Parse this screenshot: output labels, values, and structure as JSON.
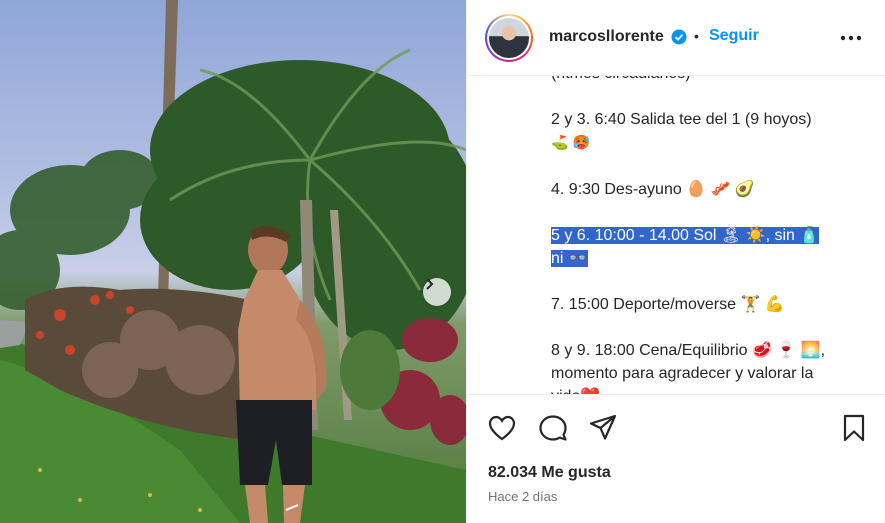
{
  "post": {
    "username": "marcosllorente",
    "follow_label": "Seguir",
    "separator": "•"
  },
  "caption": {
    "lines": [
      {
        "text": "(ritmos circadianos)",
        "highlight": false,
        "para_end": true
      },
      {
        "text": "2 y 3. 6:40 Salida tee del 1 (9 hoyos)",
        "highlight": false,
        "para_end": false
      },
      {
        "text": "⛳ 🥵",
        "highlight": false,
        "para_end": true,
        "emoji": true
      },
      {
        "text": "4. 9:30 Des-ayuno 🥚 🥓 🥑",
        "highlight": false,
        "para_end": true
      },
      {
        "text": "5 y 6. 10:00 - 14.00 Sol 🏝 ☀️, sin 🧴",
        "highlight": true,
        "para_end": false
      },
      {
        "text": "ni 👓",
        "highlight": true,
        "para_end": true
      },
      {
        "text": "7. 15:00 Deporte/moverse 🏋️ 💪",
        "highlight": false,
        "para_end": true
      },
      {
        "text": "8 y 9. 18:00 Cena/Equilibrio 🥩 🍷 🌅,",
        "highlight": false,
        "para_end": false
      },
      {
        "text": "momento para agradecer y valorar la",
        "highlight": false,
        "para_end": false
      },
      {
        "text": "vida❤️",
        "highlight": false,
        "para_end": false
      }
    ]
  },
  "stats": {
    "likes": "82.034 Me gusta",
    "time_ago": "Hace 2 días"
  },
  "icons": {
    "like": "heart-icon",
    "comment": "comment-icon",
    "share": "send-icon",
    "save": "bookmark-icon",
    "more": "more-icon",
    "verified": "verified-badge-icon",
    "next": "chevron-right-icon"
  },
  "colors": {
    "accent": "#0095f6",
    "highlight": "#3366cc",
    "muted": "#737373"
  }
}
